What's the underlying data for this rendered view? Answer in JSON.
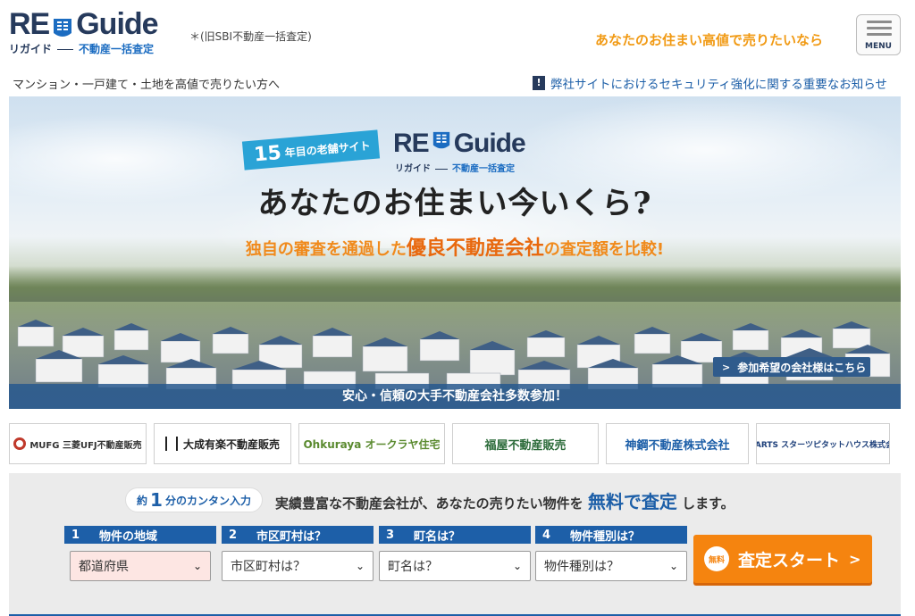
{
  "colors": {
    "brand_navy": "#263a5c",
    "brand_blue": "#1d5fa8",
    "accent_orange": "#f5840f",
    "tagline_orange": "#f19a14"
  },
  "header": {
    "logo_text_left": "RE",
    "logo_text_right": "Guide",
    "logo_reading": "リガイド",
    "logo_service": "不動産一括査定",
    "former_name": "＊(旧SBI不動産一括査定)",
    "tagline": "あなたのお住まい高値で売りたいなら",
    "menu_label": "MENU",
    "menu_icon": "hamburger-icon"
  },
  "subbar": {
    "lead": "マンション・一戸建て・土地を高値で売りたい方へ",
    "notice_icon": "exclamation-icon",
    "notice_text": "弊社サイトにおけるセキュリティ強化に関する重要なお知らせ"
  },
  "hero": {
    "badge_number": "15",
    "badge_text": "年目の老舗サイト",
    "logo_text_left": "RE",
    "logo_text_right": "Guide",
    "logo_reading": "リガイド",
    "logo_service": "不動産一括査定",
    "headline": "あなたのお住まい今いくら?",
    "subline_pre": "独自の審査を通過した",
    "subline_em": "優良不動産会社",
    "subline_post": "の査定額を比較!",
    "join_button": "参加希望の会社様はこちら",
    "bottom_banner": "安心・信頼の大手不動産会社多数参加！"
  },
  "partners": [
    {
      "name": "MUFG 三菱UFJ不動産販売",
      "color": "#c0392b"
    },
    {
      "name": "大成有楽不動産販売",
      "color": "#222222"
    },
    {
      "name": "Ohkuraya オークラヤ住宅",
      "color": "#5a8a2f"
    },
    {
      "name": "福屋不動産販売",
      "color": "#2c6b3a"
    },
    {
      "name": "神鋼不動産株式会社",
      "color": "#1d5fa8"
    },
    {
      "name": "STARTS スターツピタットハウス株式会社",
      "color": "#1d3f7a"
    }
  ],
  "search": {
    "pill_pre": "約",
    "pill_num": "1",
    "pill_post": "分のカンタン入力",
    "lead_pre": "実績豊富な不動産会社が、あなたの売りたい物件を",
    "lead_em": "無料で査定",
    "lead_post": "します。",
    "steps": [
      {
        "index": "1",
        "label": "物件の地域",
        "selected": "都道府県"
      },
      {
        "index": "2",
        "label": "市区町村は？",
        "selected": "市区町村は？"
      },
      {
        "index": "3",
        "label": "町名は？",
        "selected": "町名は？"
      },
      {
        "index": "4",
        "label": "物件種別は？",
        "selected": "物件種別は？"
      }
    ],
    "free_badge": "無料",
    "start_button": "査定スタート"
  }
}
